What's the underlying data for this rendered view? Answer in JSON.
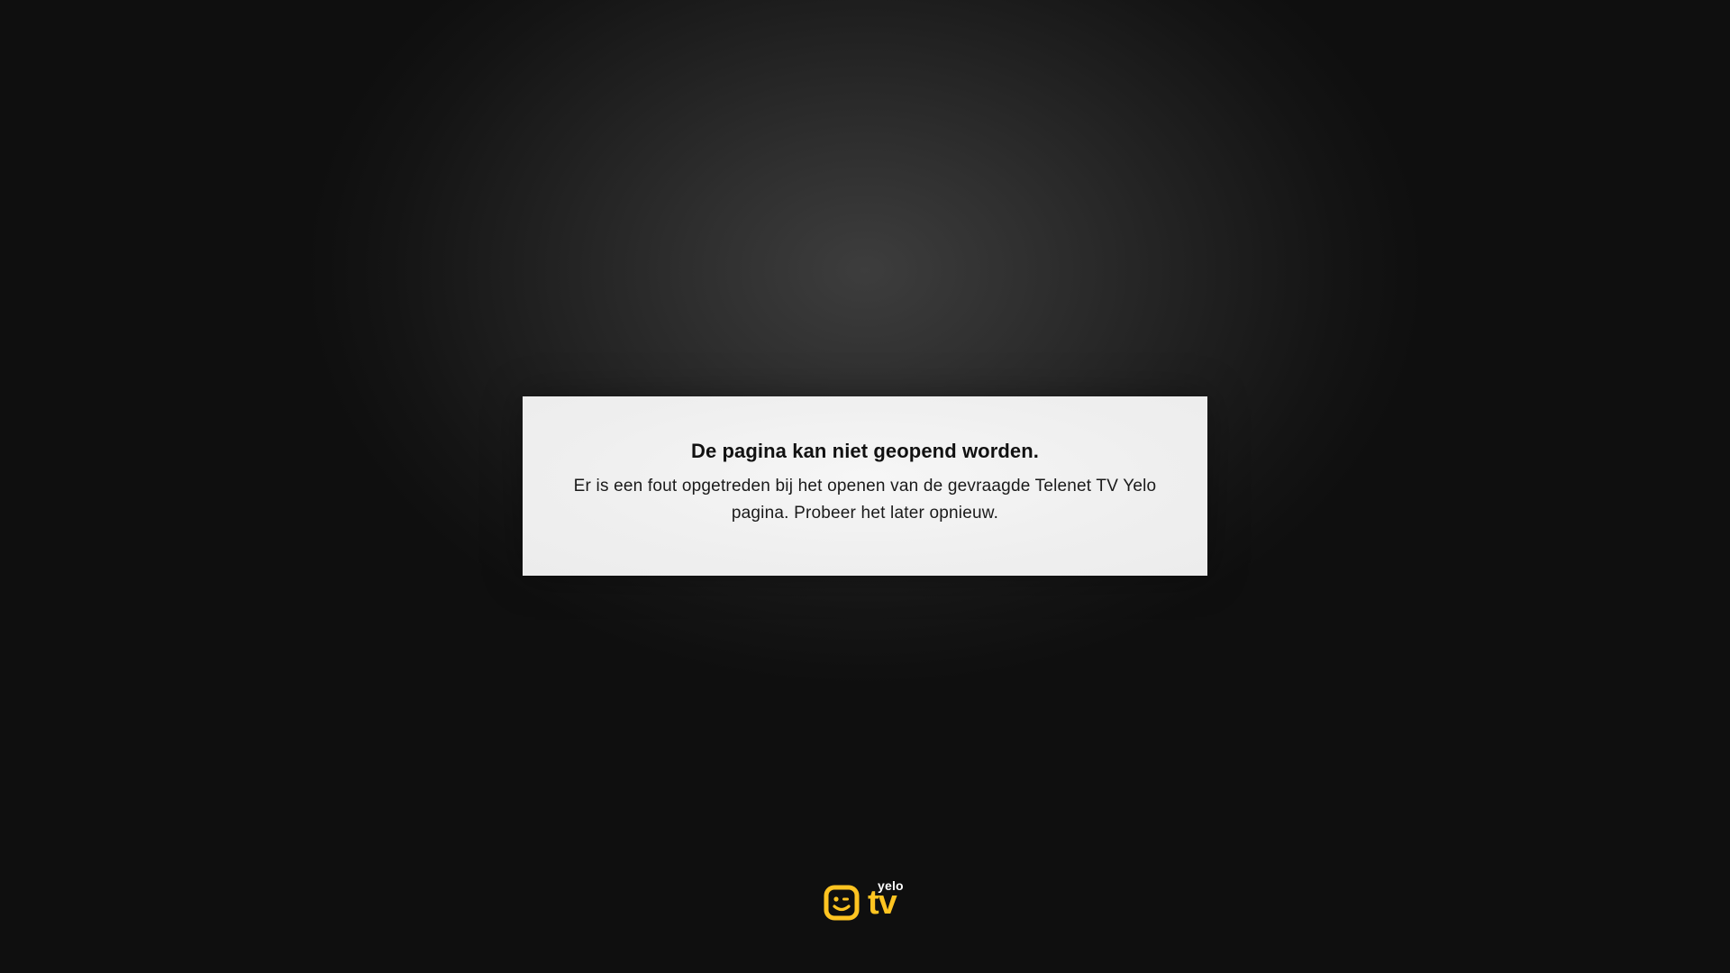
{
  "dialog": {
    "title": "De pagina kan niet geopend worden.",
    "message": "Er is een fout opgetreden bij het openen van de gevraagde Telenet TV Yelo pagina. Probeer het later opnieuw."
  },
  "logo": {
    "icon": "winking-face-icon",
    "yelo_text": "yelo",
    "tv_text": "tv",
    "brand_color": "#FFC421",
    "yelo_color": "#FFFFFF"
  },
  "theme": {
    "background": "#0F0F0F",
    "dialog_background": "#EFEFEF",
    "title_color": "#111111"
  }
}
